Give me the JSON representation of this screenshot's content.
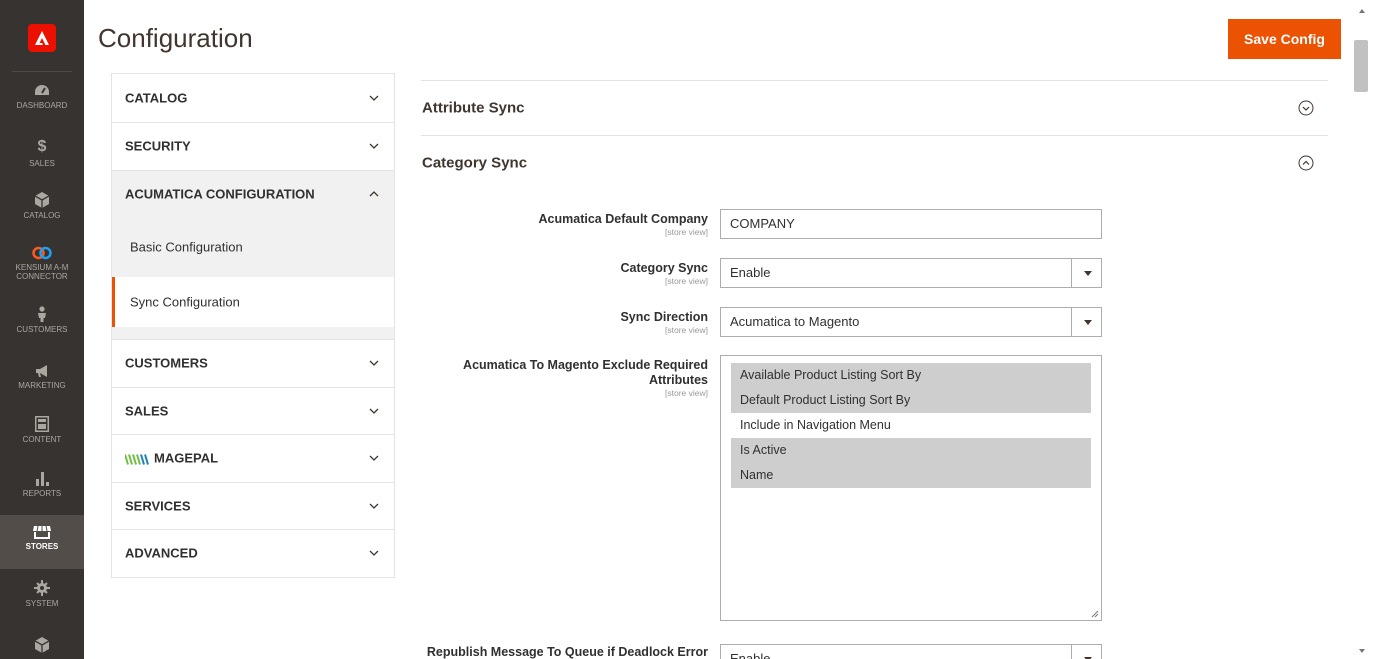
{
  "nav": {
    "items": [
      {
        "label": "DASHBOARD",
        "icon": "speedometer-icon"
      },
      {
        "label": "SALES",
        "icon": "dollar-icon"
      },
      {
        "label": "CATALOG",
        "icon": "cube-icon"
      },
      {
        "label": "KENSIUM A-M CONNECTOR",
        "label1": "KENSIUM A-M",
        "label2": "CONNECTOR",
        "icon": "kensium-logo-icon"
      },
      {
        "label": "CUSTOMERS",
        "icon": "person-icon"
      },
      {
        "label": "MARKETING",
        "icon": "megaphone-icon"
      },
      {
        "label": "CONTENT",
        "icon": "layout-icon"
      },
      {
        "label": "REPORTS",
        "icon": "bar-chart-icon"
      },
      {
        "label": "STORES",
        "icon": "storefront-icon"
      },
      {
        "label": "SYSTEM",
        "icon": "gear-icon"
      }
    ]
  },
  "header": {
    "title": "Configuration",
    "save_label": "Save Config"
  },
  "tabs": [
    {
      "label": "CATALOG"
    },
    {
      "label": "SECURITY"
    },
    {
      "label": "ACUMATICA CONFIGURATION",
      "expanded": true,
      "items": [
        "Basic Configuration",
        "Sync Configuration"
      ],
      "current": "Sync Configuration"
    },
    {
      "label": "CUSTOMERS"
    },
    {
      "label": "SALES"
    },
    {
      "label": "MAGEPAL"
    },
    {
      "label": "SERVICES"
    },
    {
      "label": "ADVANCED"
    }
  ],
  "sections": {
    "attribute_sync": "Attribute Sync",
    "category_sync": "Category Sync"
  },
  "fields": {
    "scope": "[store view]",
    "company": {
      "label": "Acumatica Default Company",
      "value": "COMPANY"
    },
    "category_sync": {
      "label": "Category Sync",
      "value": "Enable"
    },
    "sync_direction": {
      "label": "Sync Direction",
      "value": "Acumatica to Magento"
    },
    "exclude": {
      "label1": "Acumatica To Magento Exclude Required",
      "label2": "Attributes",
      "options": [
        {
          "label": "Available Product Listing Sort By",
          "selected": true
        },
        {
          "label": "Default Product Listing Sort By",
          "selected": true
        },
        {
          "label": "Include in Navigation Menu",
          "selected": false
        },
        {
          "label": "Is Active",
          "selected": true
        },
        {
          "label": "Name",
          "selected": true
        }
      ]
    },
    "republish": {
      "label": "Republish Message To Queue if Deadlock Error",
      "value": "Enable"
    }
  },
  "colors": {
    "accent": "#eb5202",
    "nav_bg": "#373330",
    "logo": "#eb1000"
  }
}
